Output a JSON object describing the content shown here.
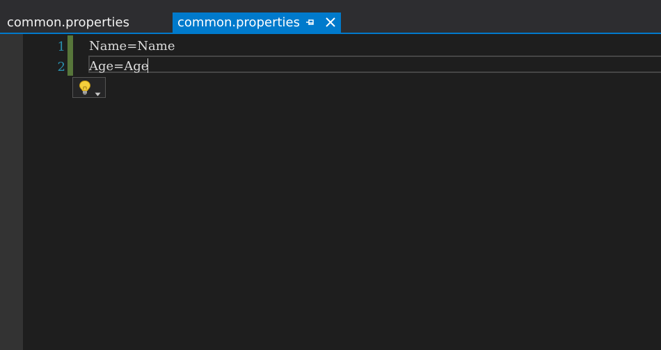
{
  "tabs": [
    {
      "label": "common.properties",
      "active": false
    },
    {
      "label": "common.properties",
      "active": true
    }
  ],
  "tab_icons": {
    "pin": "pin-icon",
    "close": "close-icon"
  },
  "editor": {
    "lines": [
      {
        "number": "1",
        "text": "Name=Name"
      },
      {
        "number": "2",
        "text": "Age=Age"
      }
    ],
    "current_line": 2,
    "quick_actions_icon": "lightbulb-icon"
  },
  "colors": {
    "accent": "#007acc",
    "background": "#1e1e1e",
    "line_number": "#2b91af",
    "change_marker": "#57763a",
    "text": "#dcdcdc"
  }
}
